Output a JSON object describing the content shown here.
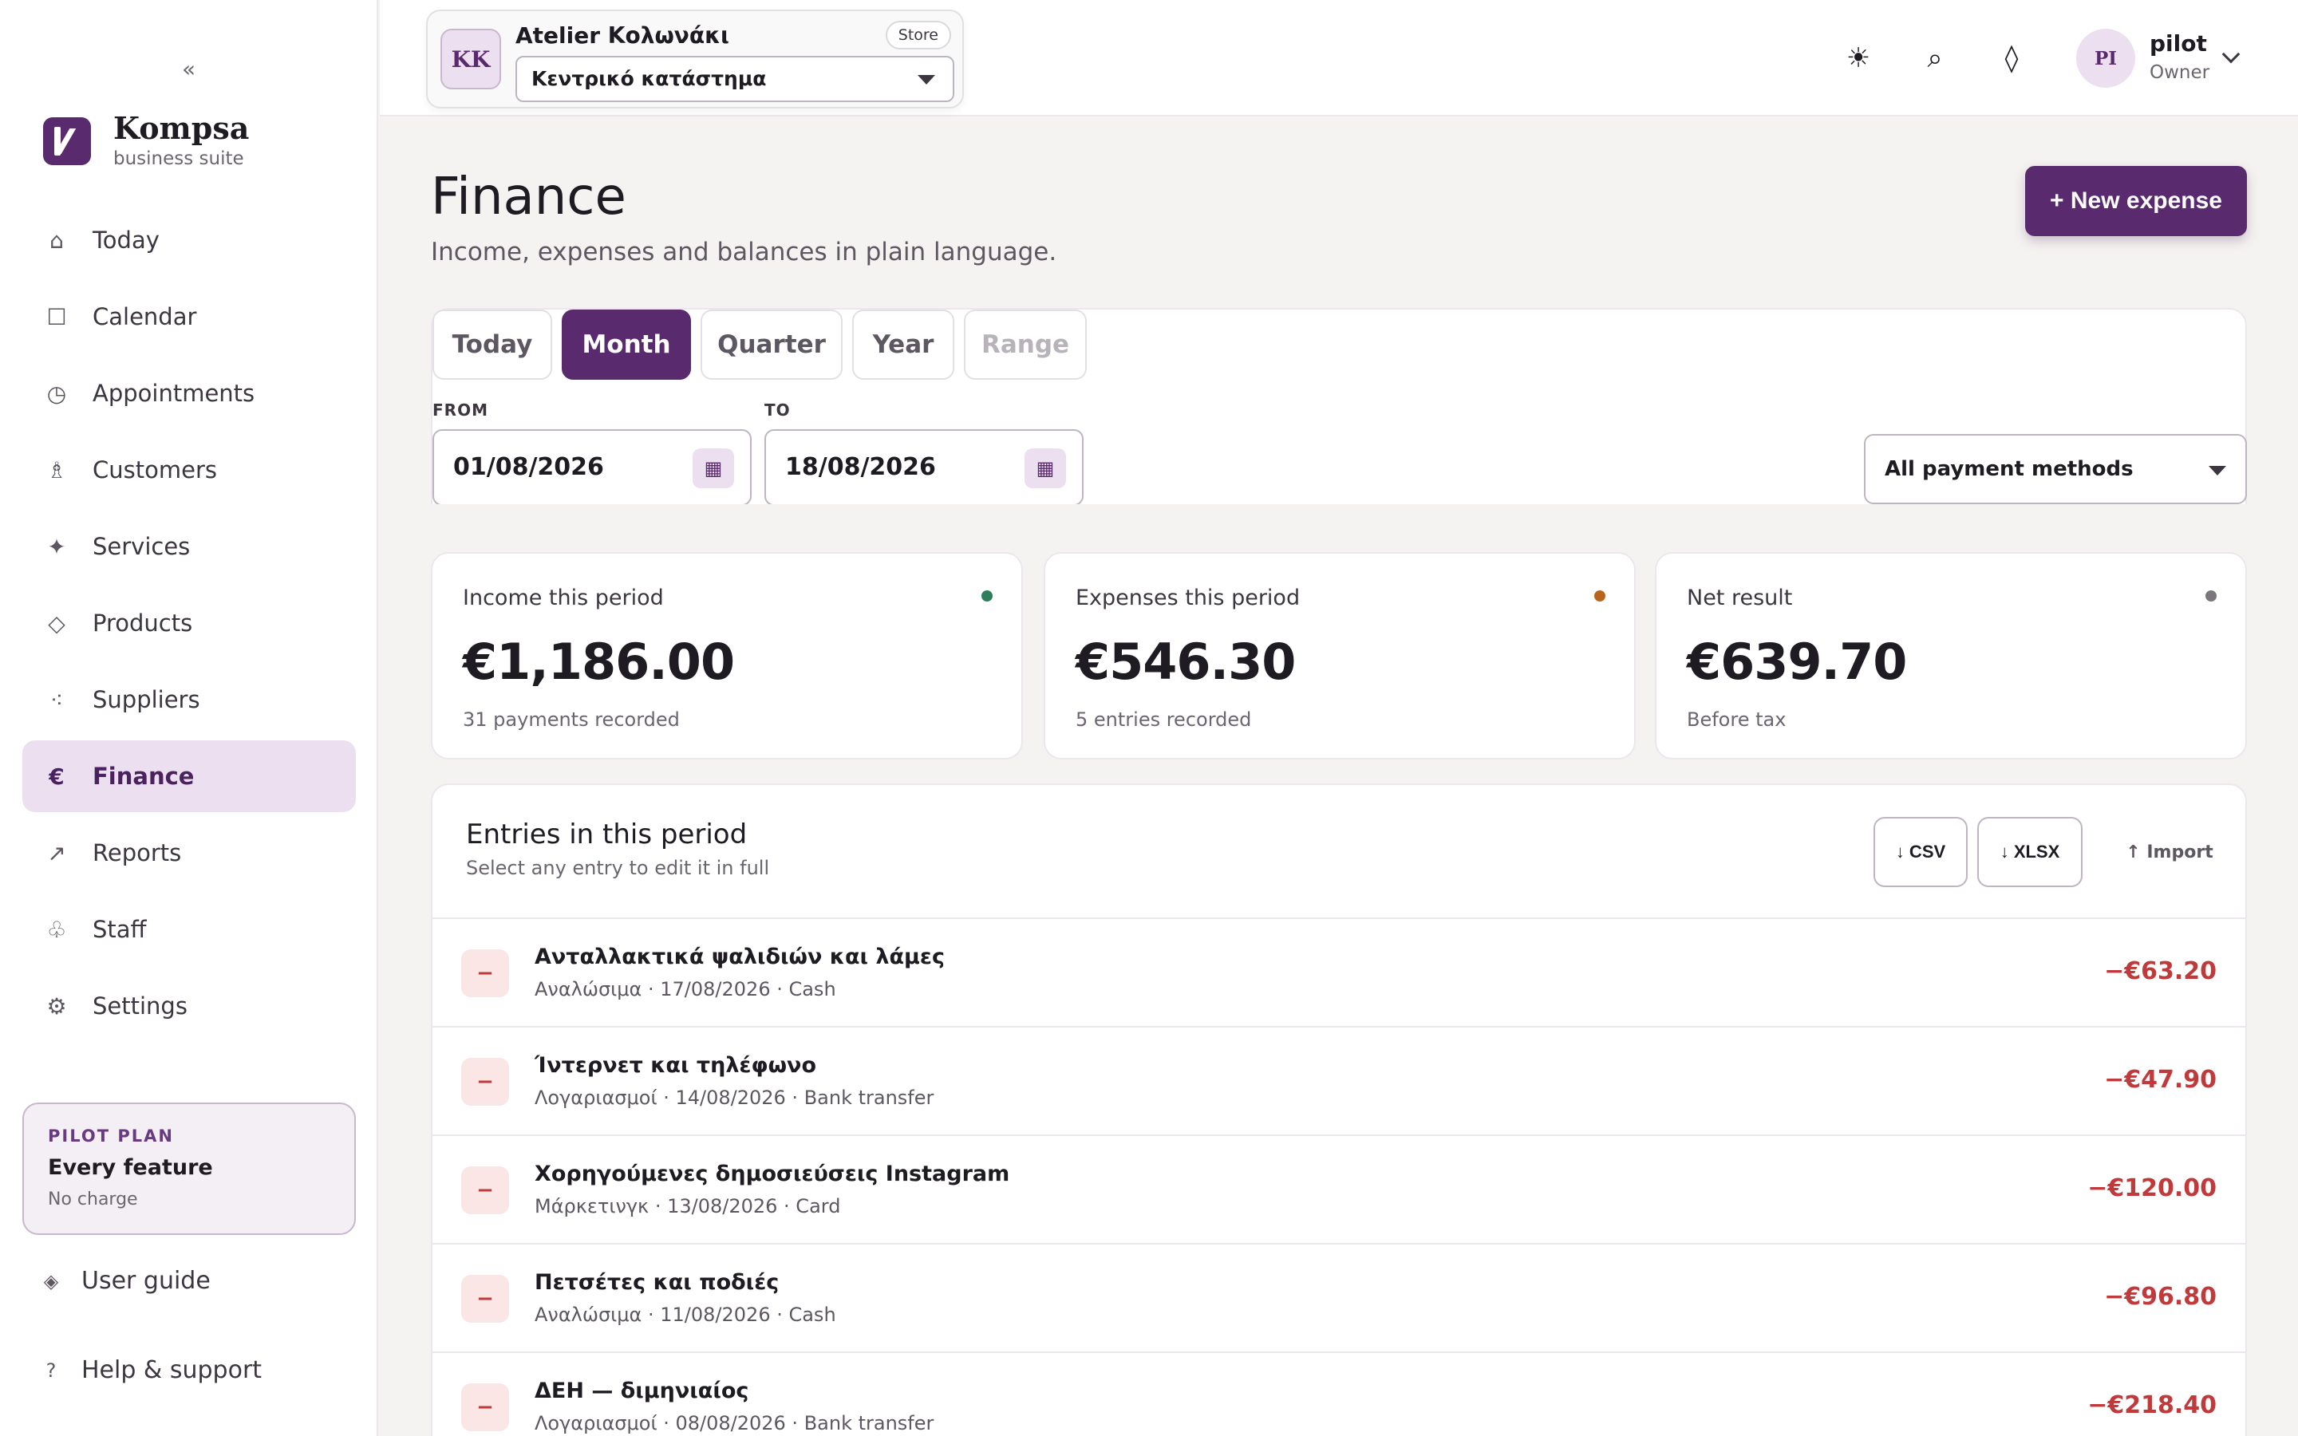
{
  "sidebar": {
    "collapse": "«",
    "brand": {
      "name": "Kompsa",
      "tagline": "business suite"
    },
    "items": [
      {
        "label": "Today",
        "icon": "⌂",
        "name": "today"
      },
      {
        "label": "Calendar",
        "icon": "☐",
        "name": "calendar"
      },
      {
        "label": "Appointments",
        "icon": "◷",
        "name": "appointments"
      },
      {
        "label": "Customers",
        "icon": "♗",
        "name": "customers"
      },
      {
        "label": "Services",
        "icon": "✦",
        "name": "services"
      },
      {
        "label": "Products",
        "icon": "◇",
        "name": "products"
      },
      {
        "label": "Suppliers",
        "icon": "⁖",
        "name": "suppliers"
      },
      {
        "label": "Finance",
        "icon": "€",
        "name": "finance",
        "active": true
      },
      {
        "label": "Reports",
        "icon": "↗",
        "name": "reports"
      },
      {
        "label": "Staff",
        "icon": "♧",
        "name": "staff"
      },
      {
        "label": "Settings",
        "icon": "⚙",
        "name": "settings"
      }
    ],
    "plan": {
      "tag": "PILOT PLAN",
      "title": "Every feature",
      "sub": "No charge"
    },
    "guide": {
      "icon": "◈",
      "label": "User guide"
    },
    "help": {
      "icon": "?",
      "label": "Help & support"
    }
  },
  "topbar": {
    "store": {
      "initials": "KK",
      "name": "Atelier Κολωνάκι",
      "badge": "Store",
      "location": "Κεντρικό κατάστημα"
    },
    "icons": {
      "theme": "☀",
      "search": "⌕",
      "gem": "◊"
    },
    "user": {
      "initials": "PI",
      "name": "pilot",
      "role": "Owner"
    }
  },
  "page": {
    "title": "Finance",
    "subtitle": "Income, expenses and balances in plain language.",
    "new_expense": "+ New expense"
  },
  "filters": {
    "tabs": [
      {
        "label": "Today",
        "state": "normal"
      },
      {
        "label": "Month",
        "state": "active"
      },
      {
        "label": "Quarter",
        "state": "normal"
      },
      {
        "label": "Year",
        "state": "normal"
      },
      {
        "label": "Range",
        "state": "disabled"
      }
    ],
    "from_label": "FROM",
    "from_value": "01/08/2026",
    "to_label": "TO",
    "to_value": "18/08/2026",
    "calendar_icon": "▦",
    "payment_method": "All payment methods"
  },
  "stats": [
    {
      "label": "Income this period",
      "value": "€1,186.00",
      "sub": "31 payments recorded",
      "dot_color": "#2e7d5b"
    },
    {
      "label": "Expenses this period",
      "value": "€546.30",
      "sub": "5 entries recorded",
      "dot_color": "#b8651b"
    },
    {
      "label": "Net result",
      "value": "€639.70",
      "sub": "Before tax",
      "dot_color": "#7a767c"
    }
  ],
  "entries": {
    "title": "Entries in this period",
    "subtitle": "Select any entry to edit it in full",
    "csv": "↓ CSV",
    "xlsx": "↓ XLSX",
    "import": "↑ Import",
    "rows": [
      {
        "sign": "−",
        "title": "Ανταλλακτικά ψαλιδιών και λάμες",
        "meta": "Αναλώσιμα · 17/08/2026 · Cash",
        "amount": "−€63.20"
      },
      {
        "sign": "−",
        "title": "Ίντερνετ και τηλέφωνο",
        "meta": "Λογαριασμοί · 14/08/2026 · Bank transfer",
        "amount": "−€47.90"
      },
      {
        "sign": "−",
        "title": "Χορηγούμενες δημοσιεύσεις Instagram",
        "meta": "Μάρκετινγκ · 13/08/2026 · Card",
        "amount": "−€120.00"
      },
      {
        "sign": "−",
        "title": "Πετσέτες και ποδιές",
        "meta": "Αναλώσιμα · 11/08/2026 · Cash",
        "amount": "−€96.80"
      },
      {
        "sign": "−",
        "title": "ΔΕΗ — διμηνιαίος",
        "meta": "Λογαριασμοί · 08/08/2026 · Bank transfer",
        "amount": "−€218.40"
      }
    ]
  }
}
